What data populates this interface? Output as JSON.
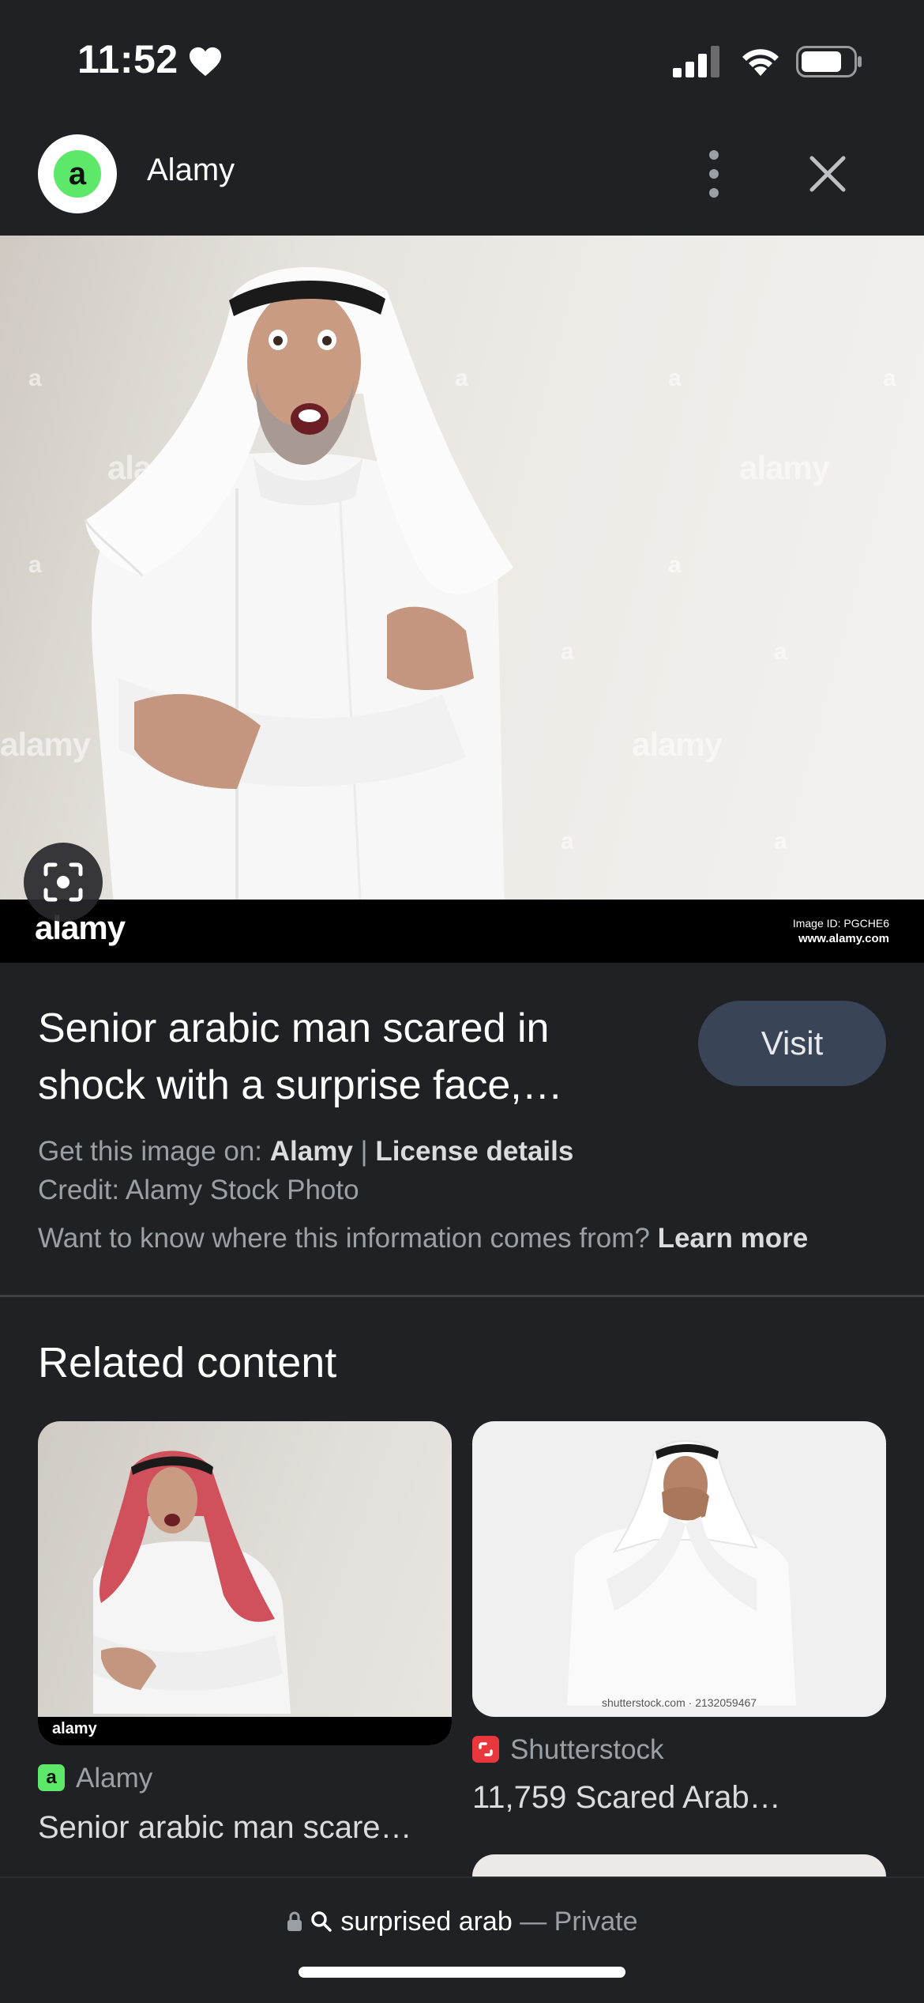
{
  "status": {
    "time": "11:52"
  },
  "header": {
    "site_name": "Alamy",
    "logo_letter": "a"
  },
  "hero": {
    "watermark": "alamy",
    "watermark_small": "a",
    "brand": "alamy",
    "image_id": "Image ID: PGCHE6",
    "site_url": "www.alamy.com"
  },
  "info": {
    "title": "Senior arabic man scared in shock with a surprise face,…",
    "visit_label": "Visit",
    "get_image_prefix": "Get this image on: ",
    "get_image_source": "Alamy",
    "separator": " | ",
    "license_label": "License details",
    "credit": "Credit: Alamy Stock Photo",
    "info_question": "Want to know where this information comes from? ",
    "learn_more": "Learn more"
  },
  "related": {
    "heading": "Related content",
    "cards": [
      {
        "source": "Alamy",
        "title": "Senior arabic man scare…",
        "brand": "alamy"
      },
      {
        "source": "Shutterstock",
        "title": "11,759 Scared Arab…",
        "caption": "shutterstock.com · 2132059467"
      }
    ]
  },
  "bottom": {
    "query": "surprised arab",
    "mode": "— Private"
  },
  "colors": {
    "background": "#202124",
    "visit_button": "#394457",
    "alamy_green": "#5ee86a",
    "shutterstock_red": "#e8383d"
  }
}
